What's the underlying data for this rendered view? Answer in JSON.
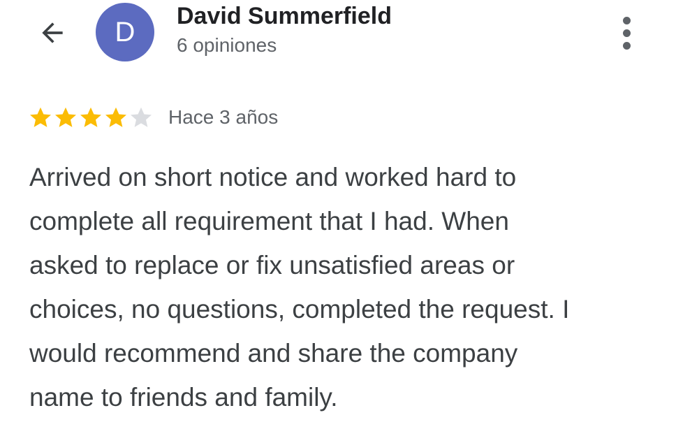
{
  "header": {
    "back_icon": "arrow-left-icon",
    "avatar_letter": "D",
    "avatar_color": "#5c6bc0",
    "reviewer_name": "David Summerfield",
    "review_count": "6 opiniones",
    "more_icon": "more-vert-icon"
  },
  "review": {
    "rating": 4,
    "max_rating": 5,
    "star_filled_color": "#fbbc04",
    "star_empty_color": "#dadce0",
    "time_ago": "Hace 3 años",
    "text_lines": [
      "Arrived on short notice and worked hard to",
      "complete all requirement that I had. When",
      "asked to replace or fix unsatisfied areas or",
      "choices, no questions, completed the request. I",
      "would recommend and share the company",
      "name to friends and family."
    ]
  }
}
